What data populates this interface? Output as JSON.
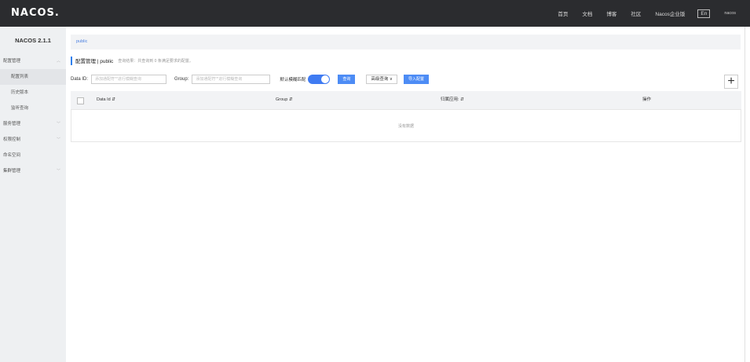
{
  "header": {
    "logo": "NACOS.",
    "nav": [
      "首页",
      "文档",
      "博客",
      "社区",
      "Nacos企业版"
    ],
    "lang": "En",
    "user": "nacos"
  },
  "sidebar": {
    "version": "NACOS 2.1.1",
    "items": [
      {
        "label": "配置管理",
        "sub": false,
        "chevron": "^"
      },
      {
        "label": "配置列表",
        "sub": true,
        "active": true
      },
      {
        "label": "历史版本",
        "sub": true
      },
      {
        "label": "监听查询",
        "sub": true
      },
      {
        "label": "服务管理",
        "sub": false,
        "chevron": "v"
      },
      {
        "label": "权限控制",
        "sub": false,
        "chevron": "v"
      },
      {
        "label": "命名空间",
        "sub": false
      },
      {
        "label": "集群管理",
        "sub": false,
        "chevron": "v"
      }
    ]
  },
  "namespace_bar": {
    "label": "public"
  },
  "page": {
    "title": "配置管理 | public",
    "subtitle": "查询结果：共查询到 0 条满足要求的配置。"
  },
  "filters": {
    "data_id_label": "Data ID:",
    "data_id_placeholder": "添加通配符'*'进行模糊查询",
    "group_label": "Group:",
    "group_placeholder": "添加通配符'*'进行模糊查询",
    "fuzzy_label": "默认模糊匹配",
    "fuzzy_enabled": true,
    "search_button": "查询",
    "advanced_button": "高级查询 ∨",
    "import_button": "导入配置"
  },
  "table": {
    "columns": [
      "Data Id ⇵",
      "Group ⇵",
      "归属应用: ⇵",
      "操作"
    ],
    "empty_text": "没有数据"
  },
  "colors": {
    "topbar": "#2b2c2f",
    "accent": "#4d8cf5",
    "sidebar": "#eef0f2"
  }
}
